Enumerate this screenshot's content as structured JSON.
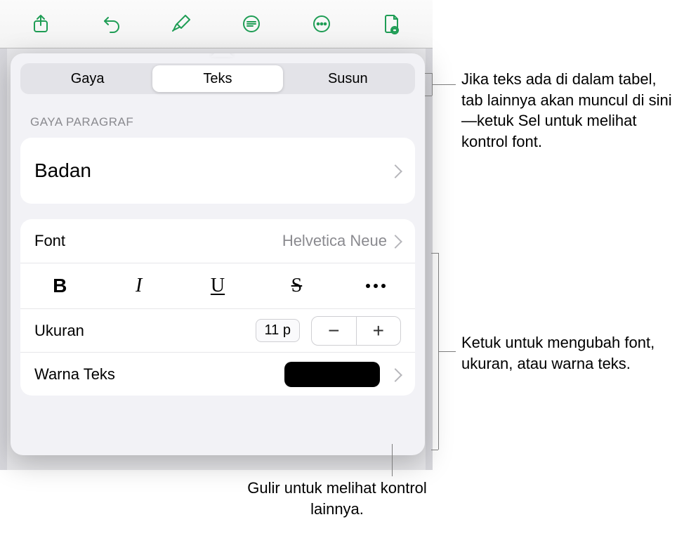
{
  "toolbar": {
    "icons": [
      "share-icon",
      "undo-icon",
      "format-brush-icon",
      "list-icon",
      "more-icon",
      "preview-icon"
    ]
  },
  "tabs": {
    "gaya": "Gaya",
    "teks": "Teks",
    "susun": "Susun"
  },
  "section_label": "GAYA PARAGRAF",
  "paragraph_style": "Badan",
  "font": {
    "label": "Font",
    "value": "Helvetica Neue"
  },
  "style_btns": {
    "bold": "B",
    "italic": "I",
    "underline": "U",
    "strike": "S"
  },
  "size": {
    "label": "Ukuran",
    "value": "11 p",
    "minus": "−",
    "plus": "+"
  },
  "text_color": {
    "label": "Warna Teks",
    "swatch_hex": "#000000"
  },
  "callouts": {
    "tabs": "Jika teks ada di dalam tabel, tab lainnya akan muncul di sini—ketuk Sel untuk melihat kontrol font.",
    "font_section": "Ketuk untuk mengubah font, ukuran, atau warna teks.",
    "scroll": "Gulir untuk melihat kontrol lainnya."
  }
}
